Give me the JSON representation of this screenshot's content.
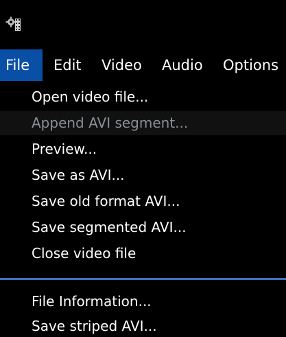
{
  "menubar": {
    "items": [
      "File",
      "Edit",
      "Video",
      "Audio",
      "Options"
    ],
    "active_index": 0
  },
  "dropdown": {
    "items": [
      {
        "label": "Open video file...",
        "state": "normal"
      },
      {
        "label": "Append AVI segment...",
        "state": "disabled-highlighted"
      },
      {
        "label": "Preview...",
        "state": "normal"
      },
      {
        "label": "Save as AVI...",
        "state": "normal"
      },
      {
        "label": "Save old format AVI...",
        "state": "normal"
      },
      {
        "label": "Save segmented AVI...",
        "state": "normal"
      },
      {
        "label": "Close video file",
        "state": "normal"
      }
    ],
    "items_after_separator": [
      {
        "label": "File Information...",
        "state": "normal"
      },
      {
        "label": "Save striped AVI...",
        "state": "normal"
      }
    ]
  },
  "icons": {
    "app": "gear-film-icon"
  },
  "colors": {
    "background": "#000000",
    "menu_active": "#0a4fa6",
    "separator": "#3a73c0",
    "disabled_text": "#8a8f96",
    "highlight_row": "#111111"
  }
}
